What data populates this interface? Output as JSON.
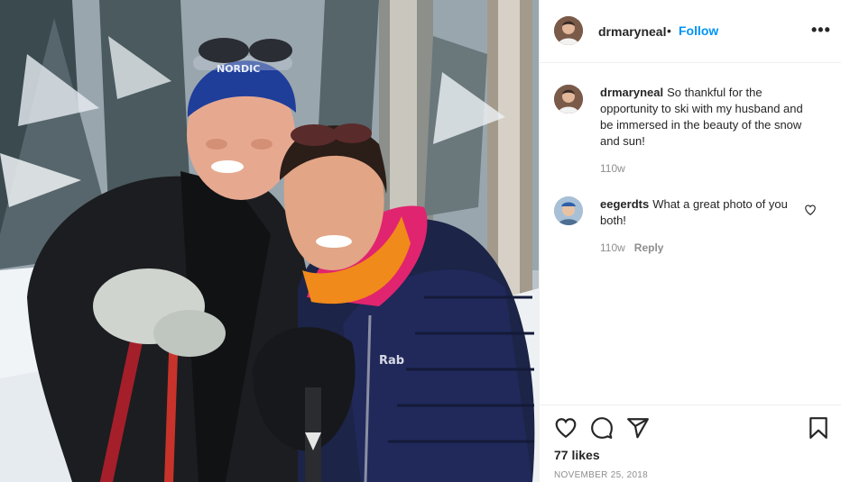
{
  "photo": {
    "description_icon": "post-photo",
    "jacket_logo": "Rab",
    "hat_text": "NORDIC"
  },
  "header": {
    "username": "drmaryneal",
    "separator": "•",
    "follow_label": "Follow",
    "more_icon": "more-options-icon",
    "more_label": "•••"
  },
  "caption": {
    "username": "drmaryneal",
    "text": "So thankful for the opportunity to ski with my husband and be immersed in the beauty of the snow and sun!",
    "age": "110w"
  },
  "comments": [
    {
      "username": "eegerdts",
      "text": "What a great photo of you both!",
      "age": "110w",
      "reply_label": "Reply"
    }
  ],
  "actions": {
    "like_icon": "heart-icon",
    "comment_icon": "comment-icon",
    "share_icon": "share-icon",
    "save_icon": "bookmark-icon"
  },
  "likes": "77 likes",
  "date": "NOVEMBER 25, 2018",
  "colors": {
    "accent": "#0095f6",
    "text": "#262626",
    "muted": "#8e8e8e",
    "border": "#efefef"
  }
}
